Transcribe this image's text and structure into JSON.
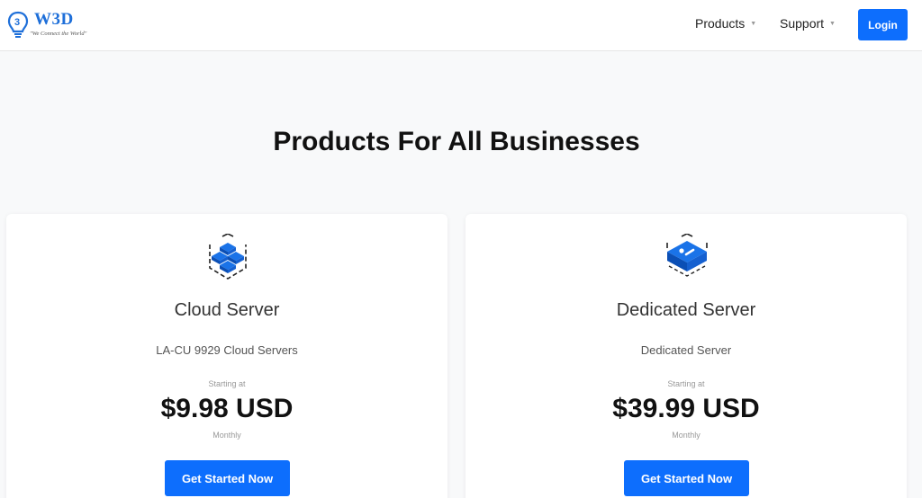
{
  "header": {
    "logo_text": "W3D",
    "logo_tagline": "\"We Connect the World\"",
    "nav": [
      {
        "label": "Products"
      },
      {
        "label": "Support"
      }
    ],
    "login_label": "Login"
  },
  "main": {
    "title": "Products For All Businesses",
    "products": [
      {
        "name": "Cloud Server",
        "description": "LA-CU 9929 Cloud Servers",
        "starting_label": "Starting at",
        "price": "$9.98 USD",
        "period": "Monthly",
        "cta_label": "Get Started Now",
        "icon": "cloud-blocks-icon"
      },
      {
        "name": "Dedicated Server",
        "description": "Dedicated Server",
        "starting_label": "Starting at",
        "price": "$39.99 USD",
        "period": "Monthly",
        "cta_label": "Get Started Now",
        "icon": "server-box-icon"
      }
    ]
  },
  "colors": {
    "accent": "#0d6efd",
    "logo_blue": "#1e6fd9",
    "background": "#f8f9fa"
  }
}
